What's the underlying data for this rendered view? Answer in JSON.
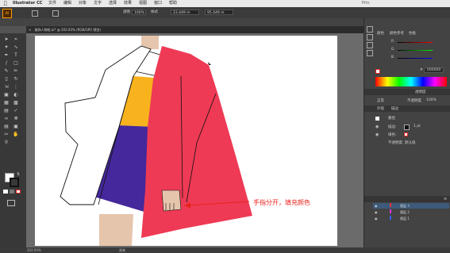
{
  "menubar": {
    "apple": "",
    "app_name": "Illustrator CC",
    "items": [
      "文件",
      "编辑",
      "对象",
      "文字",
      "选择",
      "效果",
      "视图",
      "窗口",
      "帮助"
    ],
    "workspace": "Prin"
  },
  "control_bar": {
    "opacity_label": "透明",
    "opacity_value": "100%",
    "style_label": "样式",
    "x_value": "23.449 m",
    "y_value": "95.449 m"
  },
  "document_tab": {
    "title": "服饰人物绘.ai* @ 202.93% (RGB/GPU 预览)"
  },
  "status_bar": {
    "zoom": "202.93%",
    "tool": "画笔"
  },
  "color_panel": {
    "tab1": "颜色",
    "tab2": "颜色参考",
    "tab3": "色板",
    "channels": [
      "R",
      "G",
      "B"
    ],
    "hex": "000000"
  },
  "transparency_panel": {
    "tab1": "透明度",
    "blend_mode": "正常",
    "opacity_label": "不透明度",
    "opacity_value": "100%"
  },
  "appearance_panel": {
    "tab1": "外观",
    "tab2": "描边",
    "title": "路径",
    "stroke_label": "描边:",
    "stroke_value": "1 pt",
    "fill_label": "填色:",
    "opacity_row": "不透明度: 默认值"
  },
  "layers_panel": {
    "rows": [
      "图层 3",
      "图层 2",
      "图层 1"
    ]
  },
  "annotation": {
    "text": "手指分开，填充颜色"
  },
  "colors": {
    "jacket_red": "#ee3a55",
    "skirt_purple": "#45289b",
    "top_yellow": "#f7b21e",
    "skin": "#e6c5ad",
    "annotation_red": "#e8231e"
  }
}
